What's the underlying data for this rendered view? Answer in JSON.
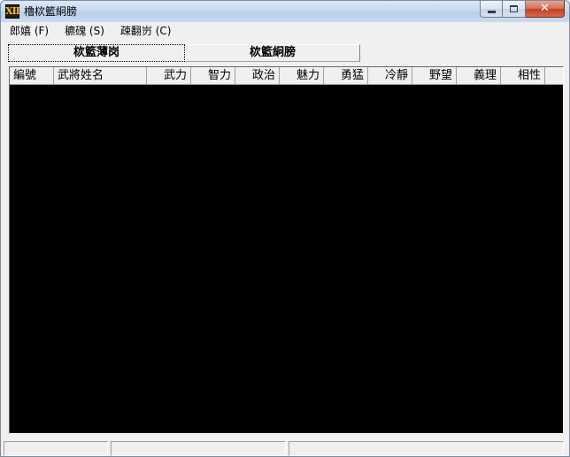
{
  "window": {
    "title": "櫓栨籃絅膀",
    "icon_glyph": "XII",
    "icon_color": "#e8c02a"
  },
  "caption": {
    "close_glyph": "✕"
  },
  "menu": {
    "items": [
      {
        "label": "郎嬉 (F)"
      },
      {
        "label": "穮磈 (S)"
      },
      {
        "label": "疎翻岃 (C)"
      }
    ]
  },
  "tabs": [
    {
      "label": "栨籃薄岗",
      "active": true
    },
    {
      "label": "栨籃絅膀",
      "active": false
    }
  ],
  "table": {
    "columns": [
      {
        "label": "編號"
      },
      {
        "label": "武將姓名"
      },
      {
        "label": "武力"
      },
      {
        "label": "智力"
      },
      {
        "label": "政治"
      },
      {
        "label": "魅力"
      },
      {
        "label": "勇猛"
      },
      {
        "label": "冷靜"
      },
      {
        "label": "野望"
      },
      {
        "label": "義理"
      },
      {
        "label": "相性"
      }
    ],
    "rows": []
  },
  "statusbar": {
    "panes": [
      "",
      "",
      ""
    ]
  }
}
